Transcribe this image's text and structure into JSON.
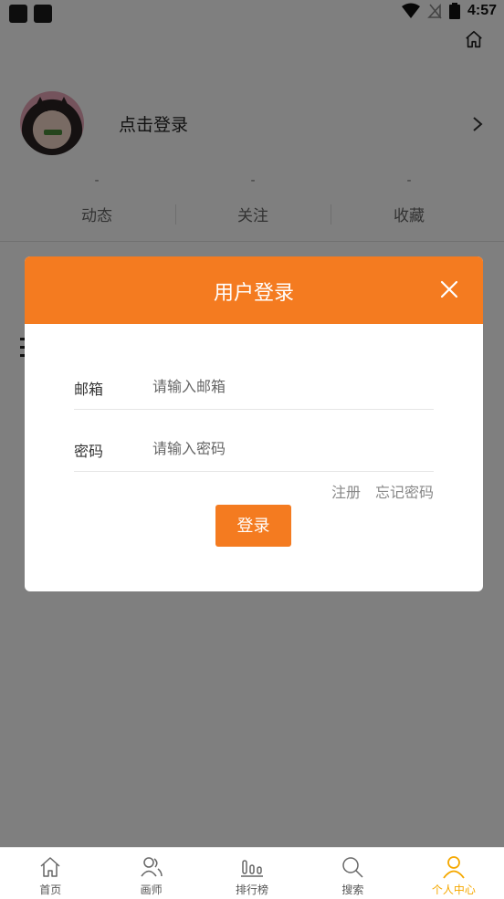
{
  "status_bar": {
    "time": "4:57"
  },
  "profile": {
    "login_prompt": "点击登录"
  },
  "stats": [
    {
      "value": "-",
      "label": "动态"
    },
    {
      "value": "-",
      "label": "关注"
    },
    {
      "value": "-",
      "label": "收藏"
    }
  ],
  "dialog": {
    "title": "用户登录",
    "email": {
      "label": "邮箱",
      "placeholder": "请输入邮箱",
      "value": ""
    },
    "password": {
      "label": "密码",
      "placeholder": "请输入密码",
      "value": ""
    },
    "register_link": "注册",
    "forgot_link": "忘记密码",
    "submit_label": "登录"
  },
  "tabs": [
    {
      "label": "首页",
      "icon": "home-icon",
      "active": false
    },
    {
      "label": "画师",
      "icon": "artists-icon",
      "active": false
    },
    {
      "label": "排行榜",
      "icon": "ranking-icon",
      "active": false
    },
    {
      "label": "搜索",
      "icon": "search-icon",
      "active": false
    },
    {
      "label": "个人中心",
      "icon": "user-icon",
      "active": true
    }
  ],
  "colors": {
    "accent": "#f47b20",
    "tab_active": "#f5a800"
  }
}
